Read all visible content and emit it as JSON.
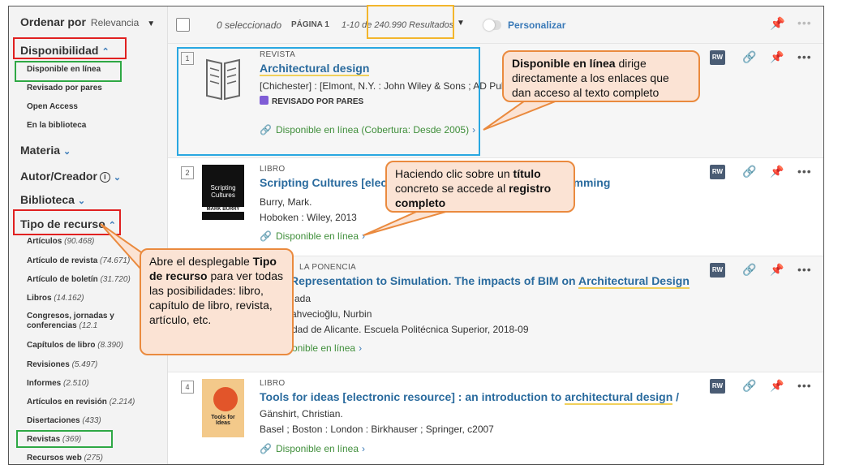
{
  "sidebar": {
    "sort_label": "Ordenar por",
    "sort_value": "Relevancia",
    "availability": {
      "heading": "Disponibilidad",
      "items": [
        "Disponible en línea",
        "Revisado por pares",
        "Open Access",
        "En la biblioteca"
      ]
    },
    "materia": "Materia",
    "autor": "Autor/Creador",
    "biblioteca": "Biblioteca",
    "tipo": {
      "heading": "Tipo de recurso",
      "items": [
        {
          "label": "Artículos",
          "count": "(90.468)"
        },
        {
          "label": "Artículo de revista",
          "count": "(74.671)"
        },
        {
          "label": "Artículo de boletín",
          "count": "(31.720)"
        },
        {
          "label": "Libros",
          "count": "(14.162)"
        },
        {
          "label": "Congresos, jornadas y conferencias",
          "count": "(12.1"
        },
        {
          "label": "Capítulos de libro",
          "count": "(8.390)"
        },
        {
          "label": "Revisiones",
          "count": "(5.497)"
        },
        {
          "label": "Informes",
          "count": "(2.510)"
        },
        {
          "label": "Artículos en revisión",
          "count": "(2.214)"
        },
        {
          "label": "Disertaciones",
          "count": "(433)"
        },
        {
          "label": "Revistas",
          "count": "(369)"
        },
        {
          "label": "Recursos web",
          "count": "(275)"
        }
      ]
    }
  },
  "toolbar": {
    "selected": "0 seleccionado",
    "page": "PÁGINA 1",
    "results": "1-10 de 240.990 Resultados",
    "personalize": "Personalizar"
  },
  "results": [
    {
      "num": "1",
      "type": "REVISTA",
      "title": "Architectural design",
      "line1": "[Chichester] : [Elmont, N.Y. : John Wiley & Sons ; AD Pub",
      "peer": "REVISADO POR PARES",
      "online": "Disponible en línea (Cobertura: Desde 2005)"
    },
    {
      "num": "2",
      "type": "LIBRO",
      "title_a": "Scripting Cultures [elec",
      "title_b": "n and Programming",
      "line1": "Burry, Mark.",
      "line2": "Hoboken : Wiley, 2013",
      "online": "Disponible en línea",
      "thumb_title": "Scripting Cultures",
      "thumb_author": "MARK BURRY"
    },
    {
      "num": "3",
      "type": "LA PONENCIA",
      "title_a": "Representation to Simulation. The impacts of BIM on ",
      "title_u": "Architectural Design",
      "line1": "ada",
      "line2": "ahvecioğlu, Nurbin",
      "line3": "dad de Alicante. Escuela Politécnica Superior, 2018-09",
      "online": "onible en línea"
    },
    {
      "num": "4",
      "type": "LIBRO",
      "title_a": "Tools for ideas [electronic resource] : an introduction to ",
      "title_u": "architectural design",
      "title_c": " /",
      "line1": "Gänshirt, Christian.",
      "line2": "Basel ; Boston : London : Birkhauser ; Springer, c2007",
      "online": "Disponible en línea",
      "thumb_title": "Tools for Ideas"
    }
  ],
  "actions": {
    "rw": "RW"
  },
  "callouts": {
    "online_b": "Disponible en línea",
    "online_rest": " dirige directamente a los enlaces que dan acceso al texto completo",
    "title_pre": "Haciendo clic sobre un ",
    "title_b": "título",
    "title_mid": " concreto se accede al ",
    "title_b2": "registro completo",
    "tipo_pre": "Abre el desplegable ",
    "tipo_b": "Tipo de recurso",
    "tipo_rest": " para ver todas las posibilidades: libro, capítulo de libro, revista, artículo, etc."
  },
  "colors": {
    "link": "#2a6b9e",
    "online": "#3f8e3a",
    "accent": "#3a7ab8",
    "callout_bg": "#fbe3d4",
    "callout_border": "#ea8a3e"
  }
}
